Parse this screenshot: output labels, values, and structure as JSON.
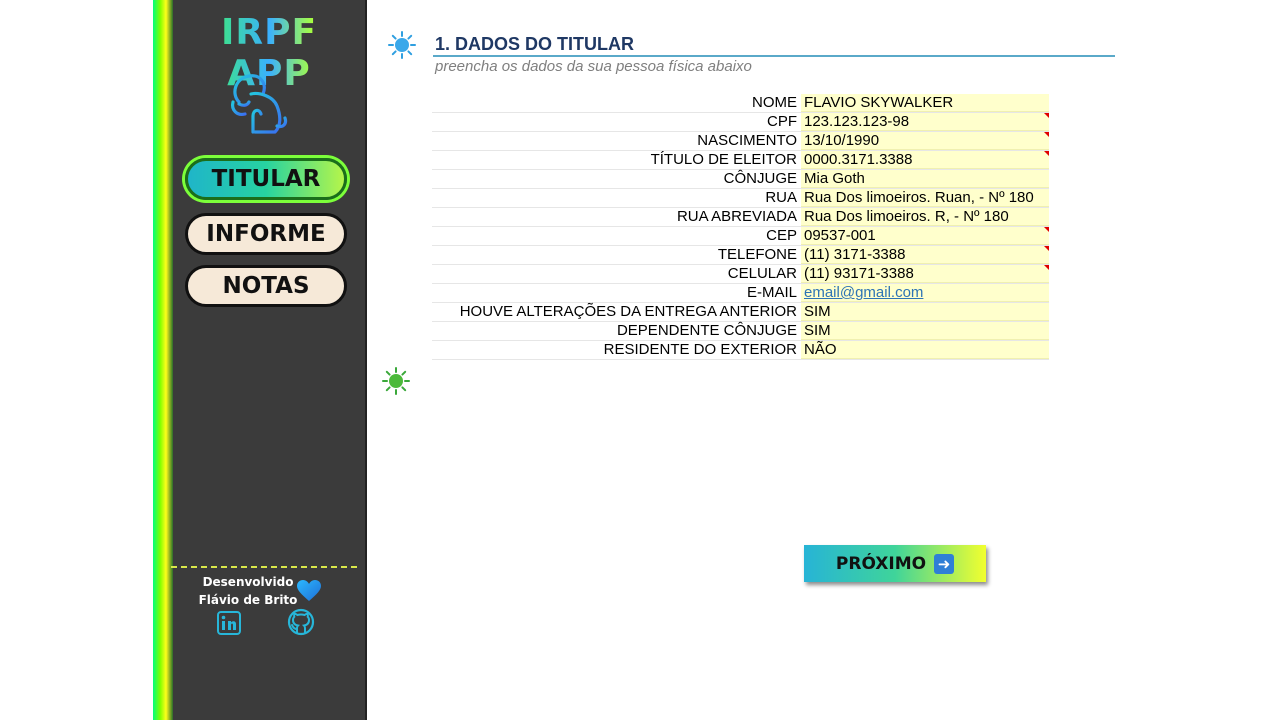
{
  "app": {
    "title": "IRPF APP"
  },
  "nav": [
    {
      "label": "TITULAR",
      "active": true
    },
    {
      "label": "INFORME",
      "active": false
    },
    {
      "label": "NOTAS",
      "active": false
    }
  ],
  "footer": {
    "line1": "Desenvolvido",
    "line2": "Flávio de Brito"
  },
  "section": {
    "title": "1. DADOS DO TITULAR",
    "subtitle": "preencha os dados da sua pessoa física abaixo"
  },
  "fields": [
    {
      "label": "NOME",
      "value": "FLAVIO SKYWALKER",
      "marker": false
    },
    {
      "label": "CPF",
      "value": "123.123.123-98",
      "marker": true
    },
    {
      "label": "NASCIMENTO",
      "value": "13/10/1990",
      "marker": true
    },
    {
      "label": "TÍTULO DE ELEITOR",
      "value": "0000.3171.3388",
      "marker": true
    },
    {
      "label": "CÔNJUGE",
      "value": "Mia Goth",
      "marker": false
    },
    {
      "label": "RUA",
      "value": "Rua Dos limoeiros. Ruan, - Nº 180",
      "marker": false
    },
    {
      "label": "RUA ABREVIADA",
      "value": "Rua Dos limoeiros. R, - Nº 180",
      "marker": false
    },
    {
      "label": "CEP",
      "value": "09537-001",
      "marker": true
    },
    {
      "label": "TELEFONE",
      "value": "(11) 3171-3388",
      "marker": true
    },
    {
      "label": "CELULAR",
      "value": "(11) 93171-3388",
      "marker": true
    },
    {
      "label": "E-MAIL",
      "value": "email@gmail.com",
      "marker": false
    },
    {
      "label": "HOUVE ALTERAÇÕES DA ENTREGA ANTERIOR",
      "value": "SIM",
      "marker": false
    },
    {
      "label": "DEPENDENTE CÔNJUGE",
      "value": "SIM",
      "marker": false
    },
    {
      "label": "RESIDENTE DO EXTERIOR",
      "value": "NÃO",
      "marker": false
    }
  ],
  "next_button": {
    "label": "PRÓXIMO"
  },
  "colors": {
    "sidebar": "#3b3b3b",
    "input_fill": "#ffffcc",
    "title": "#1f3864",
    "link": "#2e74b5"
  },
  "icons": {
    "logo": "lion-icon",
    "status_top": "sun-blue-icon",
    "status_bottom": "sun-green-icon",
    "like": "heart-icon",
    "linkedin": "linkedin-icon",
    "github": "github-icon",
    "next": "arrow-right-icon"
  }
}
